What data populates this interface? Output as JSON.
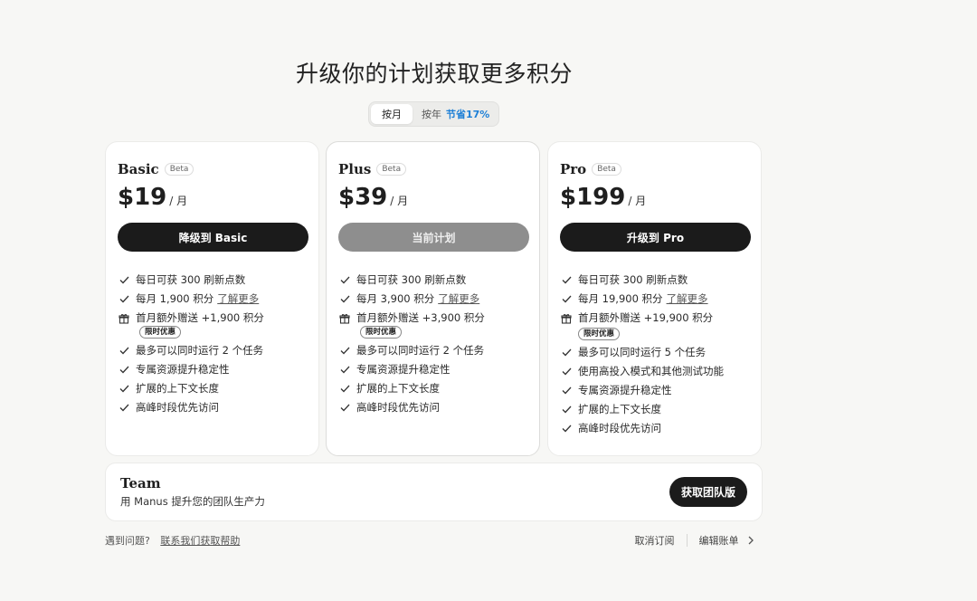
{
  "page_title": "升级你的计划获取更多积分",
  "billing_toggle": {
    "monthly_label": "按月",
    "yearly_label": "按年",
    "yearly_save_label": "节省17%"
  },
  "plans": [
    {
      "name": "Basic",
      "badge": "Beta",
      "price": "$19",
      "unit": "/ 月",
      "cta_label": "降级到 Basic",
      "features": [
        {
          "text": "每日可获 300 刷新点数"
        },
        {
          "text": "每月 1,900 积分",
          "link": "了解更多"
        },
        {
          "text": "首月额外赠送 +1,900 积分",
          "tag": "限时优惠"
        },
        {
          "text": "最多可以同时运行 2 个任务"
        },
        {
          "text": "专属资源提升稳定性"
        },
        {
          "text": "扩展的上下文长度"
        },
        {
          "text": "高峰时段优先访问"
        }
      ]
    },
    {
      "name": "Plus",
      "badge": "Beta",
      "price": "$39",
      "unit": "/ 月",
      "cta_label": "当前计划",
      "features": [
        {
          "text": "每日可获 300 刷新点数"
        },
        {
          "text": "每月 3,900 积分",
          "link": "了解更多"
        },
        {
          "text": "首月额外赠送 +3,900 积分",
          "tag": "限时优惠"
        },
        {
          "text": "最多可以同时运行 2 个任务"
        },
        {
          "text": "专属资源提升稳定性"
        },
        {
          "text": "扩展的上下文长度"
        },
        {
          "text": "高峰时段优先访问"
        }
      ]
    },
    {
      "name": "Pro",
      "badge": "Beta",
      "price": "$199",
      "unit": "/ 月",
      "cta_label": "升级到 Pro",
      "features": [
        {
          "text": "每日可获 300 刷新点数"
        },
        {
          "text": "每月 19,900 积分",
          "link": "了解更多"
        },
        {
          "text": "首月额外赠送 +19,900 积分",
          "tag": "限时优惠"
        },
        {
          "text": "最多可以同时运行 5 个任务"
        },
        {
          "text": "使用高投入模式和其他测试功能"
        },
        {
          "text": "专属资源提升稳定性"
        },
        {
          "text": "扩展的上下文长度"
        },
        {
          "text": "高峰时段优先访问"
        }
      ]
    }
  ],
  "team": {
    "name": "Team",
    "description": "用 Manus 提升您的团队生产力",
    "cta_label": "获取团队版"
  },
  "footer": {
    "question_label": "遇到问题?",
    "help_link": "联系我们获取帮助",
    "cancel_label": "取消订阅",
    "billing_label": "编辑账单"
  },
  "icons": {
    "feature_default": "check-icon",
    "feature_gift": "gift-icon",
    "billing_arrow": "chevron-right-icon"
  },
  "colors": {
    "primary_button": "#1b1b1b",
    "disabled_button": "#8e8e8e",
    "save_accent": "#1d7fd6",
    "background": "#f7f7f5"
  }
}
